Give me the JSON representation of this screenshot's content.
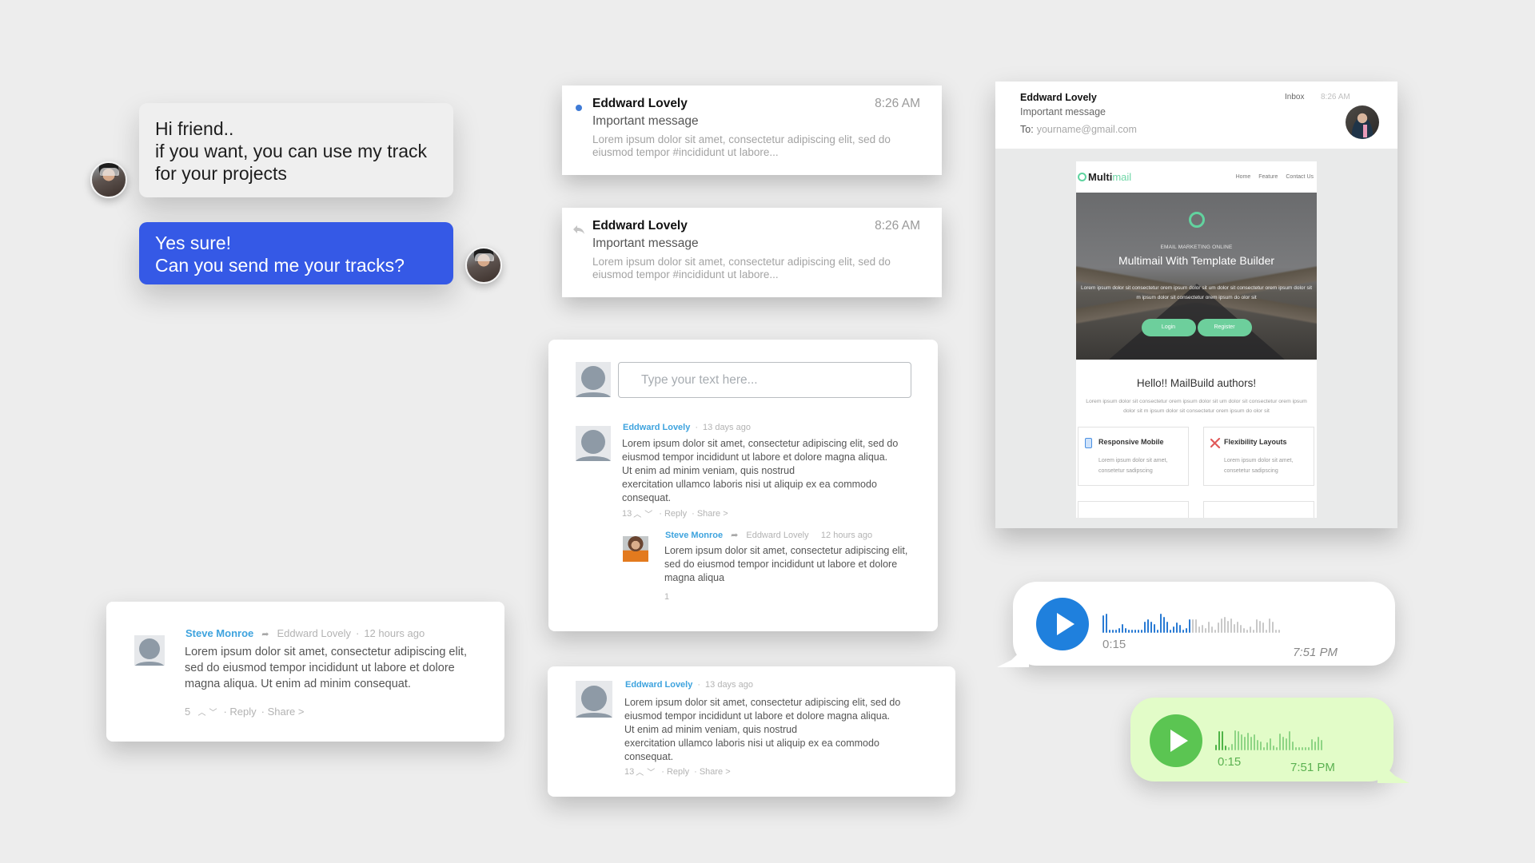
{
  "chat": {
    "incoming": {
      "lines": [
        "Hi friend..",
        "if you want, you can use my track",
        "for your projects"
      ]
    },
    "outgoing": {
      "lines": [
        "Yes sure!",
        "Can you send me your tracks?"
      ]
    },
    "colors": {
      "incoming_bg": "#efefef",
      "outgoing_bg": "#3559e6"
    }
  },
  "mail_list": [
    {
      "marker": "unread-dot",
      "sender": "Eddward Lovely",
      "time": "8:26 AM",
      "subject": "Important message",
      "preview": "Lorem ipsum dolor sit amet, consectetur adipiscing elit, sed do eiusmod tempor #incididunt ut labore..."
    },
    {
      "marker": "replied-icon",
      "sender": "Eddward Lovely",
      "time": "8:26 AM",
      "subject": "Important message",
      "preview": "Lorem ipsum dolor sit amet, consectetur adipiscing elit, sed do eiusmod tempor #incididunt ut labore..."
    }
  ],
  "email_detail": {
    "sender": "Eddward Lovely",
    "subject": "Important message",
    "to_label": "To:",
    "to_address": "yourname@gmail.com",
    "folder": "Inbox",
    "time": "8:26 AM",
    "preview": {
      "logo_main": "Multi",
      "logo_accent": "mail",
      "nav": [
        "Home",
        "Feature",
        "Contact Us"
      ],
      "hero_kicker": "EMAIL MARKETING ONLINE",
      "hero_title": "Multimail With Template Builder",
      "hero_text": "Lorem ipsum dolor sit consectetur orem ipsum dolor sit um dolor sit consectetur orem ipsum dolor sit m ipsum dolor sit consectetur orem ipsum do olor sit",
      "buttons": [
        "Login",
        "Register"
      ],
      "greeting": "Hello!! MailBuild authors!",
      "greeting_text": "Lorem ipsum dolor sit consectetur orem ipsum dolor sit um dolor sit consectetur orem ipsum dolor sit m ipsum dolor sit consectetur orem ipsum do olor sit",
      "features": [
        {
          "icon": "mobile-icon",
          "glyph": "▯",
          "color": "#4a90e2",
          "title": "Responsive Mobile",
          "text": "Lorem ipsum dolor sit amet, consetetur sadipscing"
        },
        {
          "icon": "tools-icon",
          "glyph": "✕",
          "color": "#e05a5a",
          "title": "Flexibility Layouts",
          "text": "Lorem ipsum dolor sit amet, consetetur sadipscing"
        },
        {
          "icon": "feature-icon",
          "glyph": "",
          "color": "#5bc0de",
          "title": "",
          "text": ""
        },
        {
          "icon": "feature-icon",
          "glyph": "",
          "color": "#f0ad4e",
          "title": "",
          "text": ""
        }
      ],
      "accent": "#6dcf9c"
    }
  },
  "comment_thread": {
    "input_placeholder": "Type your text here...",
    "comment": {
      "author": "Eddward Lovely",
      "sep": "·",
      "time": "13 days ago",
      "body": [
        "Lorem ipsum dolor sit amet, consectetur adipiscing elit, sed do",
        "eiusmod tempor incididunt ut labore et dolore magna aliqua.",
        " Ut enim ad minim veniam, quis nostrud",
        "exercitation ullamco laboris nisi ut aliquip ex ea commodo",
        "consequat."
      ],
      "votes": "13",
      "reply": "· Reply",
      "share": "· Share >"
    },
    "reply": {
      "author": "Steve Monroe",
      "reply_to": "Eddward Lovely",
      "time": "12 hours ago",
      "body": [
        "Lorem ipsum dolor sit amet, consectetur adipiscing elit,",
        "sed do eiusmod tempor incididunt ut labore et dolore",
        "magna aliqua"
      ],
      "votes": "1"
    }
  },
  "comment_single": {
    "author": "Steve Monroe",
    "reply_to": "Eddward Lovely",
    "sep": "·",
    "time": "12 hours ago",
    "body": [
      "Lorem ipsum dolor sit amet, consectetur adipiscing elit,",
      "sed do eiusmod tempor incididunt ut labore et dolore",
      "magna aliqua. Ut enim ad minim consequat."
    ],
    "votes": "5",
    "reply": "· Reply",
    "share": "· Share >"
  },
  "comment_bottom": {
    "author": "Eddward Lovely",
    "sep": "·",
    "time": "13 days ago",
    "body": [
      "Lorem ipsum dolor sit amet, consectetur adipiscing elit, sed do",
      "eiusmod tempor incididunt ut labore et dolore magna aliqua.",
      " Ut enim ad minim veniam, quis nostrud",
      "exercitation ullamco laboris nisi ut aliquip ex ea commodo",
      "consequat."
    ],
    "votes": "13",
    "reply": "· Reply",
    "share": "· Share >"
  },
  "voice_messages": [
    {
      "duration": "0:15",
      "time": "7:51 PM",
      "played_fraction": 0.5,
      "play_color": "#1f80dd",
      "played_color": "#2a7bd4",
      "unplayed_color": "#c9c9c9",
      "levels": [
        0.8,
        0.85,
        0.15,
        0.15,
        0.15,
        0.2,
        0.4,
        0.2,
        0.15,
        0.15,
        0.15,
        0.15,
        0.15,
        0.5,
        0.6,
        0.5,
        0.4,
        0.15,
        0.85,
        0.7,
        0.5,
        0.15,
        0.3,
        0.45,
        0.35,
        0.15,
        0.2,
        0.6,
        0.6,
        0.6,
        0.3,
        0.35,
        0.2,
        0.5,
        0.3,
        0.15,
        0.45,
        0.65,
        0.7,
        0.55,
        0.65,
        0.4,
        0.5,
        0.35,
        0.2,
        0.15,
        0.3,
        0.15,
        0.6,
        0.55,
        0.45,
        0.15,
        0.65,
        0.5,
        0.15,
        0.15
      ]
    },
    {
      "duration": "0:15",
      "time": "7:51 PM",
      "played_fraction": 0.12,
      "play_color": "#5bc552",
      "played_color": "#4fb447",
      "unplayed_color": "#8ed585",
      "levels": [
        0.25,
        0.85,
        0.85,
        0.2,
        0.15,
        0.3,
        0.9,
        0.85,
        0.7,
        0.6,
        0.8,
        0.6,
        0.7,
        0.45,
        0.4,
        0.15,
        0.35,
        0.55,
        0.2,
        0.15,
        0.75,
        0.6,
        0.55,
        0.85,
        0.4,
        0.15,
        0.15,
        0.15,
        0.15,
        0.15,
        0.5,
        0.4,
        0.6,
        0.45
      ]
    }
  ]
}
